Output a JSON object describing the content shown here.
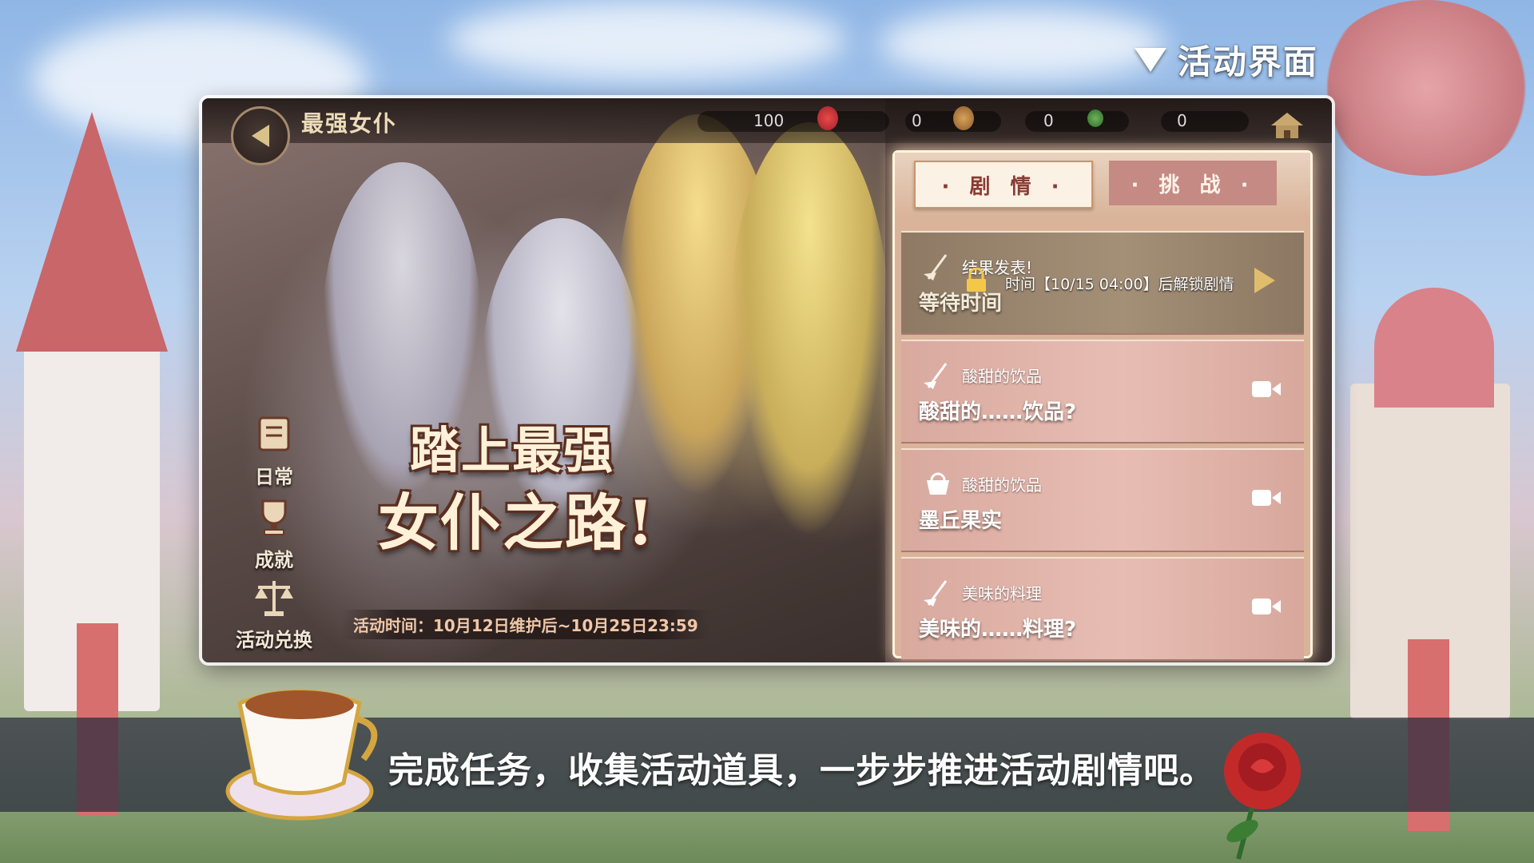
{
  "header": {
    "title": "活动界面"
  },
  "top_bar": {
    "event_name": "最强女仆",
    "resources": [
      {
        "name": "strawberry",
        "value": "100"
      },
      {
        "name": "coin-a",
        "value": "0"
      },
      {
        "name": "egg",
        "value": "0"
      },
      {
        "name": "leaf",
        "value": "0"
      }
    ]
  },
  "side_menu": [
    {
      "label": "日常",
      "icon": "scroll-icon"
    },
    {
      "label": "成就",
      "icon": "trophy-icon"
    },
    {
      "label": "活动兑换",
      "icon": "scales-icon"
    }
  ],
  "logo": {
    "line1": "踏上最强",
    "line2": "女仆之路!"
  },
  "event_period": "活动时间：10月12日维护后~10月25日23:59",
  "tabs": {
    "story": "· 剧 情 ·",
    "challenge": "· 挑 战 ·"
  },
  "story_items": [
    {
      "type": "locked",
      "subtitle": "结果发表!",
      "message": "时间【10/15 04:00】后解锁剧情",
      "title": "等待时间"
    },
    {
      "type": "video",
      "subtitle": "酸甜的饮品",
      "title": "酸甜的……饮品?"
    },
    {
      "type": "video",
      "subtitle": "酸甜的饮品",
      "title": "墨丘果实"
    },
    {
      "type": "video",
      "subtitle": "美味的料理",
      "title": "美味的……料理?"
    }
  ],
  "caption": "完成任务，收集活动道具，一步步推进活动剧情吧。",
  "colors": {
    "accent": "#8a3b33",
    "panel": "#d9b49a",
    "gold": "#e0bd6c"
  }
}
